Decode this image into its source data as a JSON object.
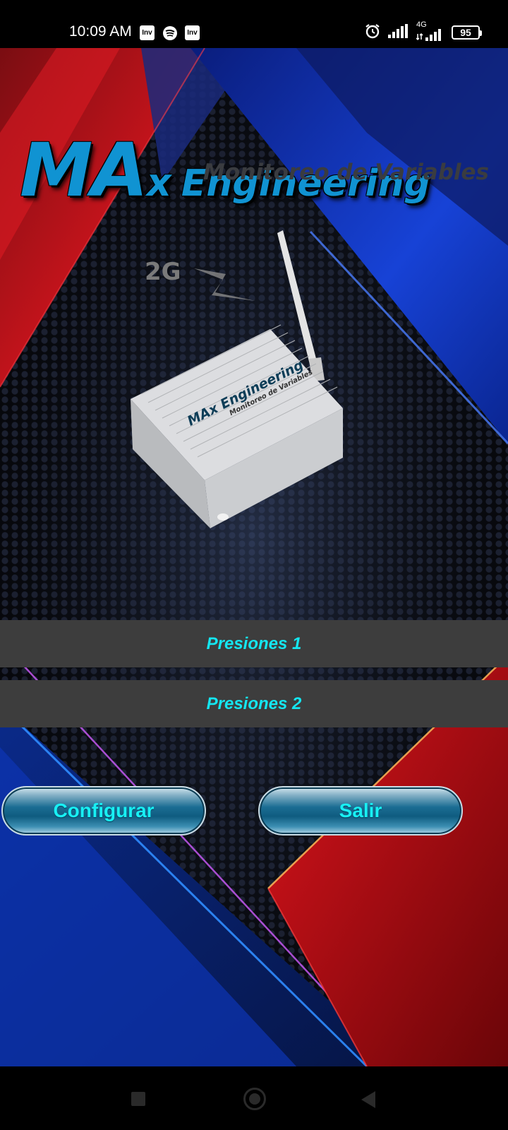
{
  "status_bar": {
    "time": "10:09 AM",
    "app_icon_1": "Inv",
    "app_icon_3": "Inv",
    "network": "4G",
    "battery": "95"
  },
  "logo": {
    "brand_ma": "MA",
    "brand_x": "x",
    "brand_engineering": "Engineering",
    "subtitle": "Monitoreo de Variables"
  },
  "device": {
    "network_label": "2G",
    "box_brand": "MAx Engineering",
    "box_subtitle": "Monitoreo de Variables"
  },
  "menu": {
    "items": [
      {
        "label": "Presiones 1"
      },
      {
        "label": "Presiones 2"
      }
    ]
  },
  "buttons": {
    "configure": "Configurar",
    "exit": "Salir"
  },
  "colors": {
    "accent_text": "#14e6f0",
    "menu_bg": "#3d3d3d",
    "brand_blue": "#1093d2"
  }
}
